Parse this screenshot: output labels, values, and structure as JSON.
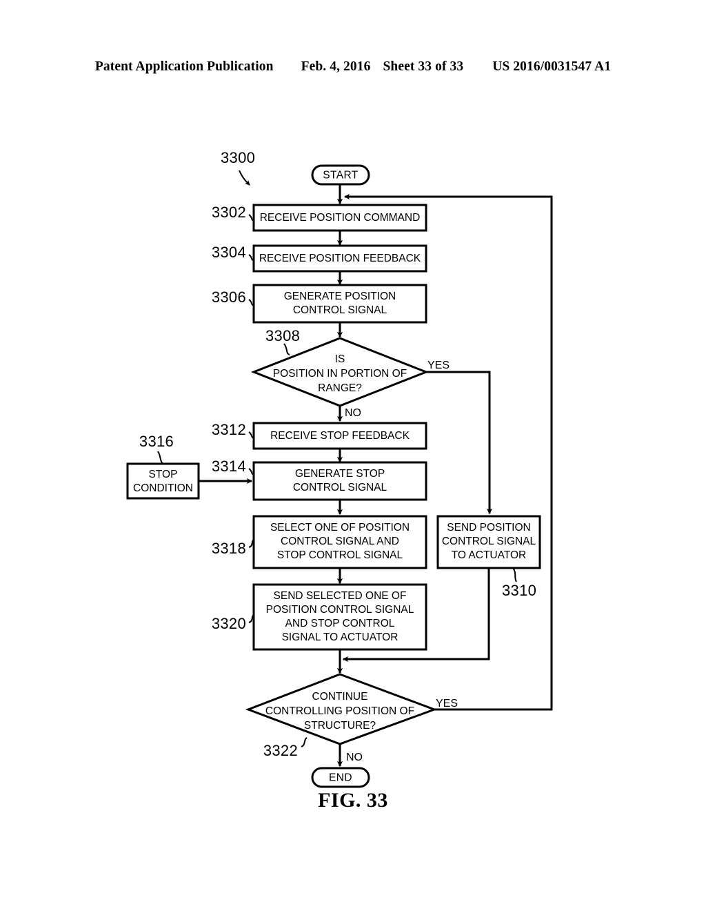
{
  "header": {
    "publication": "Patent Application Publication",
    "date": "Feb. 4, 2016",
    "sheet": "Sheet 33 of 33",
    "patent_number": "US 2016/0031547 A1"
  },
  "figure": {
    "caption": "FIG. 33",
    "diagram_reference": "3300"
  },
  "flowchart": {
    "terminals": {
      "start": "START",
      "end": "END"
    },
    "steps": [
      {
        "ref": "3302",
        "text_lines": [
          "RECEIVE POSITION COMMAND"
        ]
      },
      {
        "ref": "3304",
        "text_lines": [
          "RECEIVE POSITION FEEDBACK"
        ]
      },
      {
        "ref": "3306",
        "text_lines": [
          "GENERATE POSITION",
          "CONTROL SIGNAL"
        ]
      },
      {
        "ref": "3312",
        "text_lines": [
          "RECEIVE STOP FEEDBACK"
        ]
      },
      {
        "ref": "3314",
        "text_lines": [
          "GENERATE STOP",
          "CONTROL SIGNAL"
        ]
      },
      {
        "ref": "3316",
        "text_lines": [
          "STOP",
          "CONDITION"
        ]
      },
      {
        "ref": "3318",
        "text_lines": [
          "SELECT ONE OF POSITION",
          "CONTROL SIGNAL AND",
          "STOP CONTROL SIGNAL"
        ]
      },
      {
        "ref": "3320",
        "text_lines": [
          "SEND SELECTED ONE OF",
          "POSITION CONTROL SIGNAL",
          "AND STOP CONTROL",
          "SIGNAL TO ACTUATOR"
        ]
      },
      {
        "ref": "3310",
        "text_lines": [
          "SEND POSITION",
          "CONTROL SIGNAL",
          "TO ACTUATOR"
        ]
      }
    ],
    "decisions": [
      {
        "ref": "3308",
        "text_lines": [
          "IS",
          "POSITION IN PORTION OF",
          "RANGE?"
        ],
        "yes_label": "YES",
        "no_label": "NO"
      },
      {
        "ref": "3322",
        "text_lines": [
          "CONTINUE",
          "CONTROLLING POSITION OF",
          "STRUCTURE?"
        ],
        "yes_label": "YES",
        "no_label": "NO"
      }
    ]
  },
  "colors": {
    "ink": "#000000",
    "paper": "#ffffff"
  }
}
